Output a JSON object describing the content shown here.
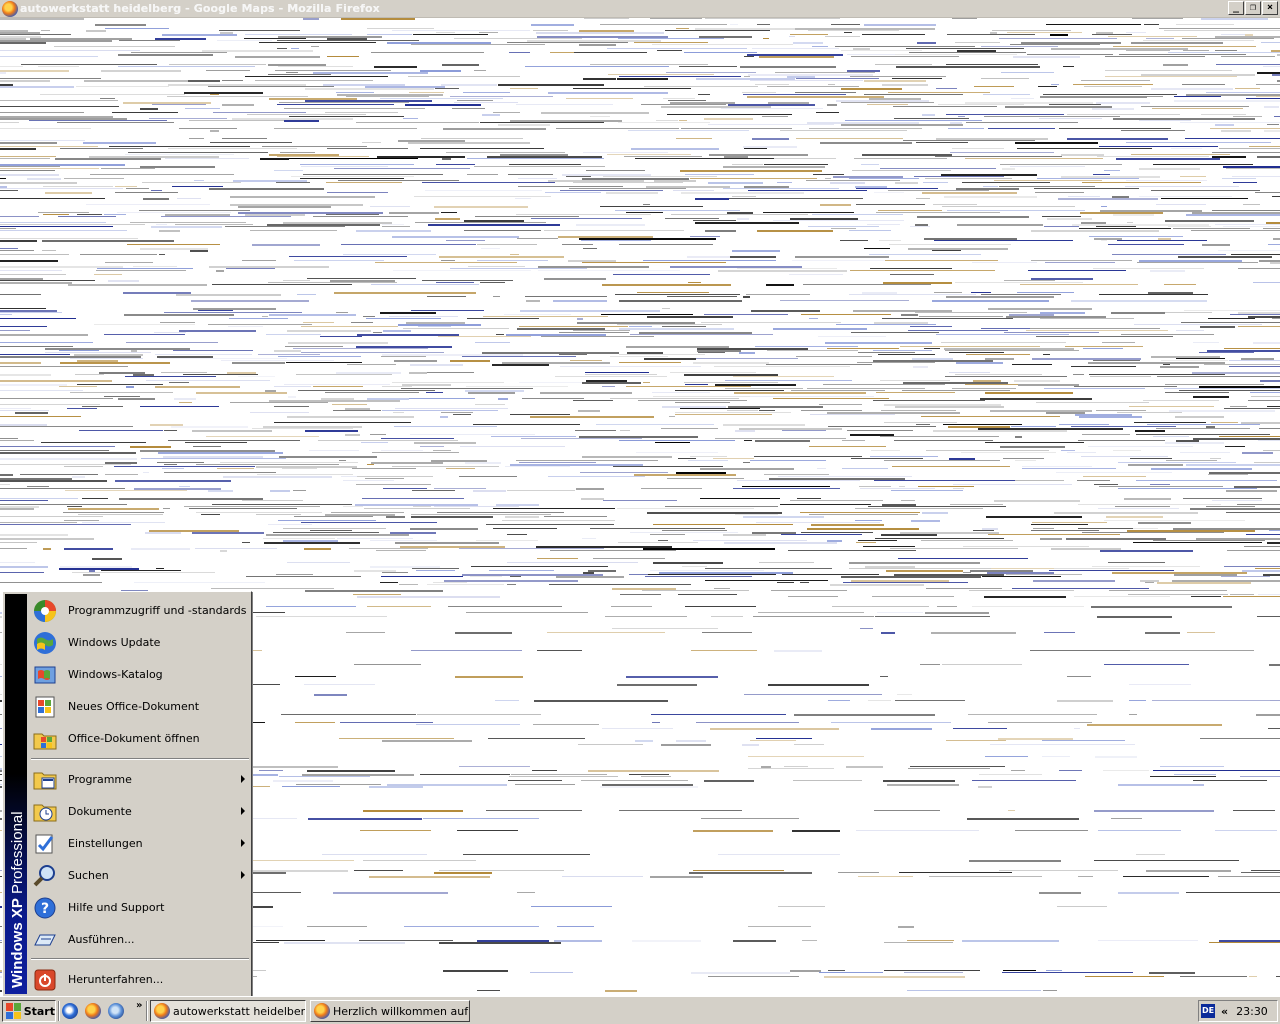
{
  "window": {
    "title": "autowerkstatt heidelberg - Google Maps - Mozilla Firefox",
    "minimize_icon": "minimize-icon",
    "restore_icon": "restore-icon",
    "close_icon": "close-icon"
  },
  "start_menu": {
    "banner_bold": "Windows XP",
    "banner_rest": " Professional",
    "pinned_items": [
      {
        "label": "Programmzugriff und -standards",
        "icon": "program-access-icon"
      },
      {
        "label": "Windows Update",
        "icon": "windows-update-icon"
      },
      {
        "label": "Windows-Katalog",
        "icon": "windows-catalog-icon"
      },
      {
        "label": "Neues Office-Dokument",
        "icon": "new-office-document-icon"
      },
      {
        "label": "Office-Dokument öffnen",
        "icon": "open-office-document-icon"
      }
    ],
    "main_items": [
      {
        "label": "Programme",
        "icon": "programs-icon",
        "submenu": true
      },
      {
        "label": "Dokumente",
        "icon": "documents-icon",
        "submenu": true
      },
      {
        "label": "Einstellungen",
        "icon": "settings-icon",
        "submenu": true
      },
      {
        "label": "Suchen",
        "icon": "search-icon",
        "submenu": true
      },
      {
        "label": "Hilfe und Support",
        "icon": "help-icon",
        "submenu": false
      },
      {
        "label": "Ausführen...",
        "icon": "run-icon",
        "submenu": false
      }
    ],
    "shutdown": {
      "label": "Herunterfahren...",
      "icon": "shutdown-icon"
    }
  },
  "taskbar": {
    "start_label": "Start",
    "quicklaunch_more": "»",
    "tasks": [
      {
        "label": "autowerkstatt heidelber...",
        "active": true
      },
      {
        "label": "Herzlich willkommen auf ...",
        "active": false
      }
    ],
    "tray": {
      "language": "DE",
      "expand": "«",
      "clock": "23:30"
    }
  }
}
